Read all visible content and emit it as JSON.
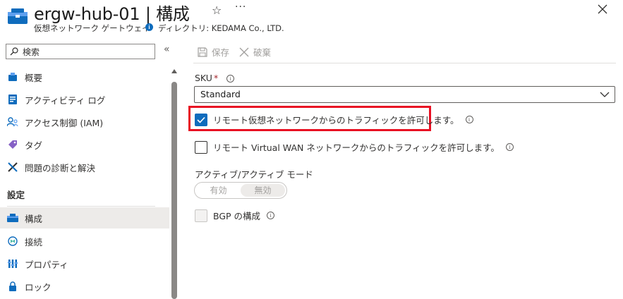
{
  "header": {
    "title": "ergw-hub-01 | 構成",
    "subtitle": "仮想ネットワーク ゲートウェイ",
    "directory": "ディレクトリ: KEDAMA Co., LTD.",
    "star_icon": "star-icon",
    "more_label": "···"
  },
  "sidebar": {
    "search_placeholder": "検索",
    "collapse_label": "«",
    "items": [
      {
        "label": "概要",
        "icon": "overview-icon"
      },
      {
        "label": "アクティビティ ログ",
        "icon": "activity-log-icon"
      },
      {
        "label": "アクセス制御 (IAM)",
        "icon": "iam-icon"
      },
      {
        "label": "タグ",
        "icon": "tag-icon"
      },
      {
        "label": "問題の診断と解決",
        "icon": "diagnose-icon"
      }
    ],
    "section_label": "設定",
    "settings_items": [
      {
        "label": "構成",
        "icon": "configuration-icon",
        "active": true
      },
      {
        "label": "接続",
        "icon": "connections-icon"
      },
      {
        "label": "プロパティ",
        "icon": "properties-icon"
      },
      {
        "label": "ロック",
        "icon": "lock-icon"
      }
    ]
  },
  "toolbar": {
    "save_label": "保存",
    "discard_label": "破棄"
  },
  "form": {
    "sku_label": "SKU",
    "required_mark": "*",
    "sku_value": "Standard",
    "allow_remote_vnet_label": "リモート仮想ネットワークからのトラフィックを許可します。",
    "allow_remote_vnet_checked": true,
    "allow_remote_vwan_label": "リモート Virtual WAN ネットワークからのトラフィックを許可します。",
    "allow_remote_vwan_checked": false,
    "active_active_label": "アクティブ/アクティブ モード",
    "active_active_on": "有効",
    "active_active_off": "無効",
    "active_active_selected": "無効",
    "bgp_label": "BGP の構成",
    "bgp_checked": false
  },
  "colors": {
    "accent": "#0f6cbd",
    "highlight": "#e81123"
  }
}
